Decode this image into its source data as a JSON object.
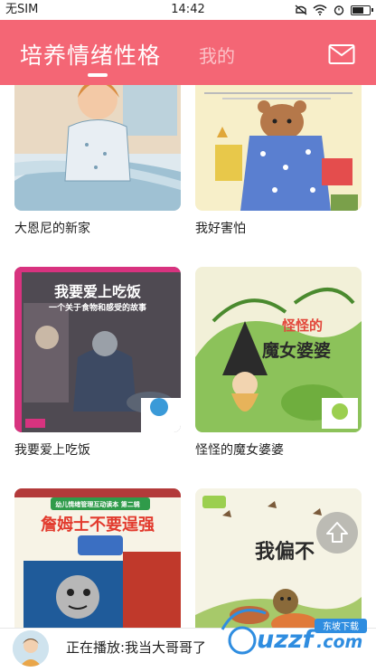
{
  "status": {
    "carrier": "无SIM",
    "time": "14:42"
  },
  "header": {
    "active_tab": "培养情绪性格",
    "inactive_tab": "我的"
  },
  "books": [
    {
      "title": "大恩尼的新家"
    },
    {
      "title": "我好害怕"
    },
    {
      "title": "我要爱上吃饭",
      "cover_title": "我要爱上吃饭",
      "cover_subtitle": "一个关于食物和感受的故事"
    },
    {
      "title": "怪怪的魔女婆婆",
      "cover_title_1": "怪怪的",
      "cover_title_2": "魔女婆婆"
    },
    {
      "title": "",
      "cover_title": "詹姆士不要逞强",
      "cover_badge": "幼儿情绪管理互动读本 第二辑"
    },
    {
      "title": "",
      "cover_title": "我偏不"
    }
  ],
  "player": {
    "now_playing": "正在播放:我当大哥哥了"
  },
  "watermark": {
    "brand": "uzzf",
    "domain": ".com",
    "tag": "东坡下载"
  },
  "colors": {
    "header": "#f46675",
    "accent": "#f46675"
  }
}
